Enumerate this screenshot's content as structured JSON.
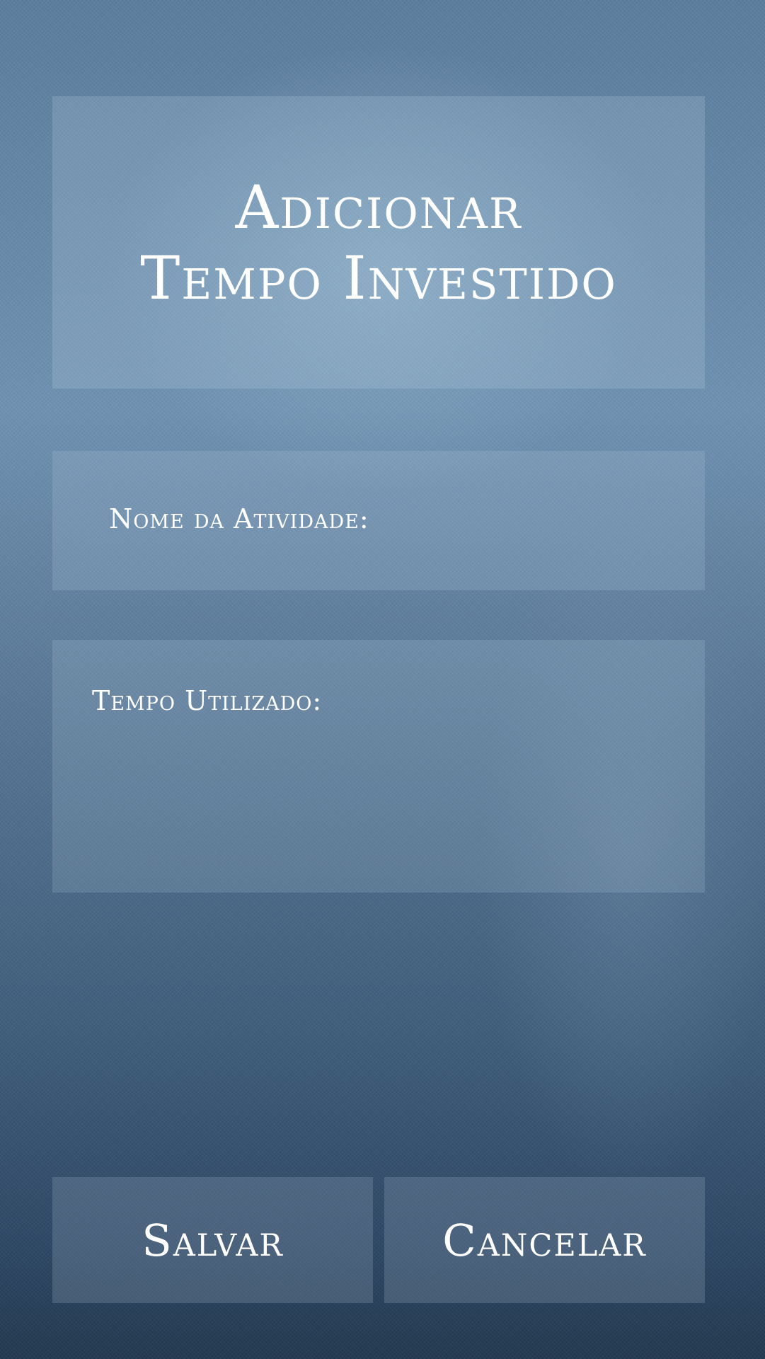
{
  "title": {
    "line1": "Adicionar",
    "line2": "Tempo Investido"
  },
  "form": {
    "activity_label": "Nome da Atividade:",
    "time_label": "Tempo Utilizado:"
  },
  "buttons": {
    "save_label": "Salvar",
    "cancel_label": "Cancelar"
  },
  "colors": {
    "text": "#ffffff",
    "background_top": "#5b7d9d",
    "background_bottom": "#22384f"
  }
}
